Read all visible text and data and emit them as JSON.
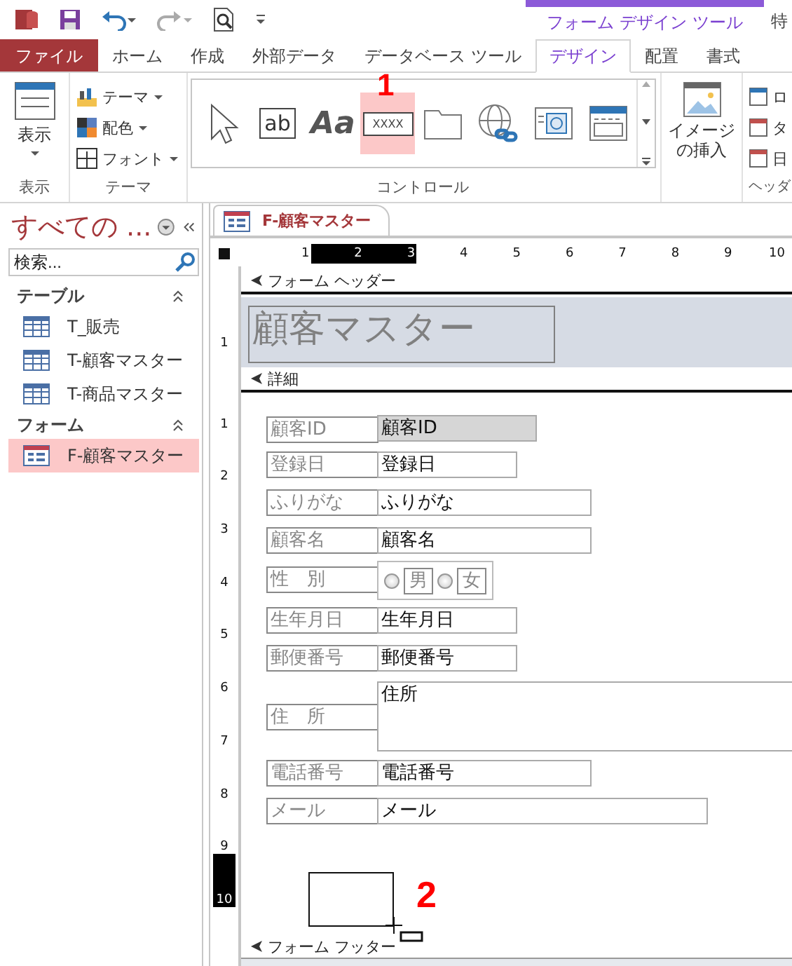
{
  "window": {
    "contextual_title": "フォーム デザイン ツール",
    "edge_text": "特"
  },
  "tabs": [
    {
      "label": "ファイル",
      "kind": "file",
      "selected": false
    },
    {
      "label": "ホーム",
      "kind": "tab",
      "selected": false
    },
    {
      "label": "作成",
      "kind": "tab",
      "selected": false
    },
    {
      "label": "外部データ",
      "kind": "tab",
      "selected": false
    },
    {
      "label": "データベース ツール",
      "kind": "tab",
      "selected": false
    },
    {
      "label": "デザイン",
      "kind": "tab",
      "selected": true
    },
    {
      "label": "配置",
      "kind": "tab",
      "selected": false
    },
    {
      "label": "書式",
      "kind": "tab",
      "selected": false
    }
  ],
  "ribbon": {
    "view": {
      "label": "表示",
      "group": "表示"
    },
    "theme": {
      "items": [
        "テーマ",
        "配色",
        "フォント"
      ],
      "group": "テーマ"
    },
    "controls": {
      "group": "コントロール",
      "items": [
        {
          "kind": "pointer",
          "selected": false
        },
        {
          "kind": "textbox",
          "label": "ab",
          "selected": false
        },
        {
          "kind": "label",
          "label": "Aa",
          "selected": false
        },
        {
          "kind": "button",
          "label": "XXXX",
          "selected": true
        },
        {
          "kind": "tab",
          "selected": false
        },
        {
          "kind": "hyperlink",
          "selected": false
        },
        {
          "kind": "browser",
          "selected": false
        },
        {
          "kind": "navigation",
          "selected": false
        }
      ]
    },
    "insert_image": {
      "lines": [
        "イメージ",
        "の挿入"
      ]
    },
    "header": {
      "items": [
        "ロ",
        "タ",
        "日"
      ],
      "group": "ヘッダ"
    }
  },
  "annotations": [
    "1",
    "2"
  ],
  "nav": {
    "title": "すべての ...",
    "search": {
      "placeholder": "検索..."
    },
    "groups": [
      {
        "label": "テーブル",
        "items": [
          {
            "label": "T_販売",
            "kind": "table",
            "selected": false
          },
          {
            "label": "T-顧客マスター",
            "kind": "table",
            "selected": false
          },
          {
            "label": "T-商品マスター",
            "kind": "table",
            "selected": false
          }
        ]
      },
      {
        "label": "フォーム",
        "items": [
          {
            "label": "F-顧客マスター",
            "kind": "form",
            "selected": true
          }
        ]
      }
    ]
  },
  "document": {
    "tab": "F-顧客マスター",
    "ruler_h": [
      {
        "label": "1",
        "selected": false
      },
      {
        "label": "2",
        "selected": true
      },
      {
        "label": "3",
        "selected": true
      },
      {
        "label": "4",
        "selected": false
      },
      {
        "label": "5",
        "selected": false
      },
      {
        "label": "6",
        "selected": false
      },
      {
        "label": "7",
        "selected": false
      },
      {
        "label": "8",
        "selected": false
      },
      {
        "label": "9",
        "selected": false
      },
      {
        "label": "10",
        "selected": false
      }
    ],
    "ruler_v_header": [
      {
        "label": "1",
        "selected": false
      }
    ],
    "ruler_v_detail": [
      {
        "label": "1",
        "selected": false
      },
      {
        "label": "2",
        "selected": false
      },
      {
        "label": "3",
        "selected": false
      },
      {
        "label": "4",
        "selected": false
      },
      {
        "label": "5",
        "selected": false
      },
      {
        "label": "6",
        "selected": false
      },
      {
        "label": "7",
        "selected": false
      },
      {
        "label": "8",
        "selected": false
      },
      {
        "label": "9",
        "selected": false
      },
      {
        "label": "10",
        "selected": true
      }
    ],
    "header_section": "フォーム ヘッダー",
    "title": "顧客マスター",
    "detail_section": "詳細",
    "footer_section": "フォーム フッター",
    "fields": [
      {
        "label": "顧客ID",
        "kind": "text",
        "value": "顧客ID",
        "disabled": true
      },
      {
        "label": "登録日",
        "kind": "text",
        "value": "登録日",
        "disabled": false
      },
      {
        "label": "ふりがな",
        "kind": "text",
        "value": "ふりがな",
        "disabled": false
      },
      {
        "label": "顧客名",
        "kind": "text",
        "value": "顧客名",
        "disabled": false
      },
      {
        "label": "性　別",
        "kind": "radio",
        "options": [
          {
            "label": "男",
            "checked": false
          },
          {
            "label": "女",
            "checked": false
          }
        ]
      },
      {
        "label": "生年月日",
        "kind": "text",
        "value": "生年月日",
        "disabled": false
      },
      {
        "label": "郵便番号",
        "kind": "text",
        "value": "郵便番号",
        "disabled": false
      },
      {
        "label": "住　所",
        "kind": "memo",
        "value": "住所",
        "disabled": false
      },
      {
        "label": "電話番号",
        "kind": "text",
        "value": "電話番号",
        "disabled": false
      },
      {
        "label": "メール",
        "kind": "text",
        "value": "メール",
        "disabled": false
      }
    ]
  }
}
